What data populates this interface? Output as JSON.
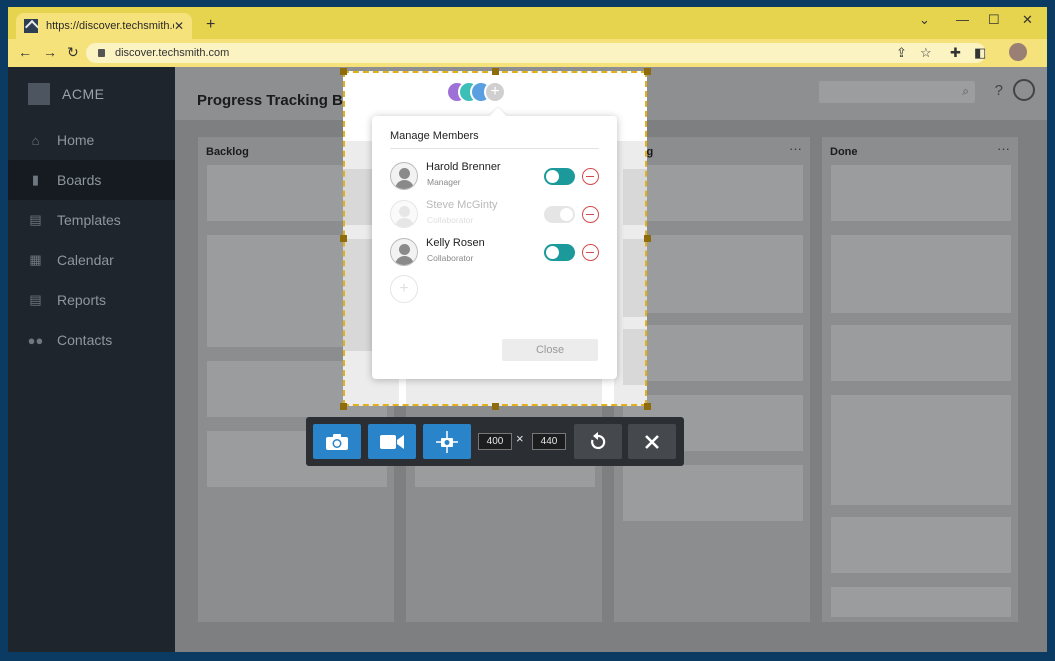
{
  "browser": {
    "tab_title": "https://discover.techsmith.com",
    "tab_close": "✕",
    "new_tab": "+",
    "url": "discover.techsmith.com",
    "window_controls": [
      "⌄",
      "—",
      "☐",
      "✕"
    ]
  },
  "sidebar": {
    "brand": "ACME",
    "items": [
      {
        "label": "Home",
        "icon": "home-icon"
      },
      {
        "label": "Boards",
        "icon": "boards-icon",
        "active": true
      },
      {
        "label": "Templates",
        "icon": "templates-icon"
      },
      {
        "label": "Calendar",
        "icon": "calendar-icon"
      },
      {
        "label": "Reports",
        "icon": "reports-icon"
      },
      {
        "label": "Contacts",
        "icon": "contacts-icon"
      }
    ]
  },
  "header": {
    "title": "Progress Tracking Board",
    "more": "···",
    "help": "?"
  },
  "columns": [
    {
      "title": "Backlog",
      "more": ""
    },
    {
      "title": "",
      "more": ""
    },
    {
      "title": "Doing",
      "more": "···"
    },
    {
      "title": "Done",
      "more": "···"
    }
  ],
  "manage_members": {
    "title": "Manage Members",
    "add_symbol": "+",
    "members": [
      {
        "name": "Harold Brenner",
        "role": "Manager",
        "enabled": true
      },
      {
        "name": "Steve McGinty",
        "role": "Collaborator",
        "enabled": false
      },
      {
        "name": "Kelly Rosen",
        "role": "Collaborator",
        "enabled": true
      }
    ],
    "close_label": "Close"
  },
  "capture_toolbar": {
    "width_value": "400",
    "height_value": "440",
    "separator": "×"
  },
  "colors": {
    "toggle_on": "#1c9a9b",
    "remove": "#d24b4b",
    "selection_border": "#e3b01d",
    "toolbar_accent": "#2a84c9"
  }
}
